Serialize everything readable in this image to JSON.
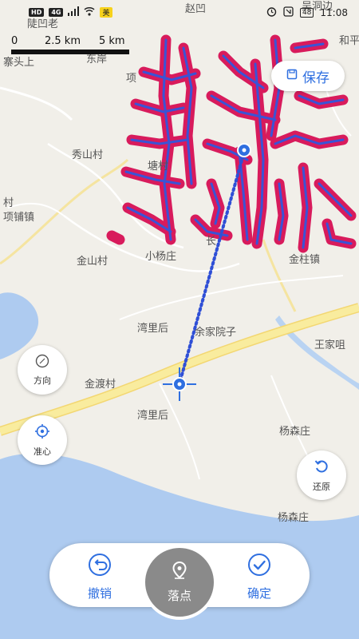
{
  "status_bar": {
    "left_tags": [
      "HD",
      "4G"
    ],
    "carrier_badge": "美",
    "battery": "48",
    "time": "11:08"
  },
  "scale_bar": {
    "labels": [
      "0",
      "2.5 km",
      "5 km"
    ]
  },
  "map_labels": [
    {
      "text": "赵凹"
    },
    {
      "text": "吴洞边"
    },
    {
      "text": "陡凹老"
    },
    {
      "text": "和平"
    },
    {
      "text": "寨头上"
    },
    {
      "text": "东岸"
    },
    {
      "text": "项"
    },
    {
      "text": "秀山村"
    },
    {
      "text": "塘村"
    },
    {
      "text": "村"
    },
    {
      "text": "项铺镇"
    },
    {
      "text": "金山村"
    },
    {
      "text": "小杨庄"
    },
    {
      "text": "长"
    },
    {
      "text": "金柱镇"
    },
    {
      "text": "湾里后"
    },
    {
      "text": "余家院子"
    },
    {
      "text": "王家咀"
    },
    {
      "text": "金渡村"
    },
    {
      "text": "湾里后"
    },
    {
      "text": "杨森庄"
    },
    {
      "text": "杨森庄"
    }
  ],
  "buttons": {
    "save": "保存",
    "direction": "方向",
    "center": "准心",
    "restore": "还原",
    "undo": "撤销",
    "drop_point": "落点",
    "confirm": "确定"
  },
  "colors": {
    "accent": "#2f6fe0",
    "track_red": "#d81b5c",
    "track_blue": "#3a53d6",
    "water": "#aecbf0",
    "road": "#f6e39a",
    "land": "#f1efe9",
    "drop_button": "#8a8a8a"
  },
  "icons": {
    "save": "save-icon",
    "direction": "compass-icon",
    "center": "crosshair-icon",
    "restore": "restore-icon",
    "undo": "undo-icon",
    "drop_point": "location-pin-icon",
    "confirm": "check-icon"
  }
}
